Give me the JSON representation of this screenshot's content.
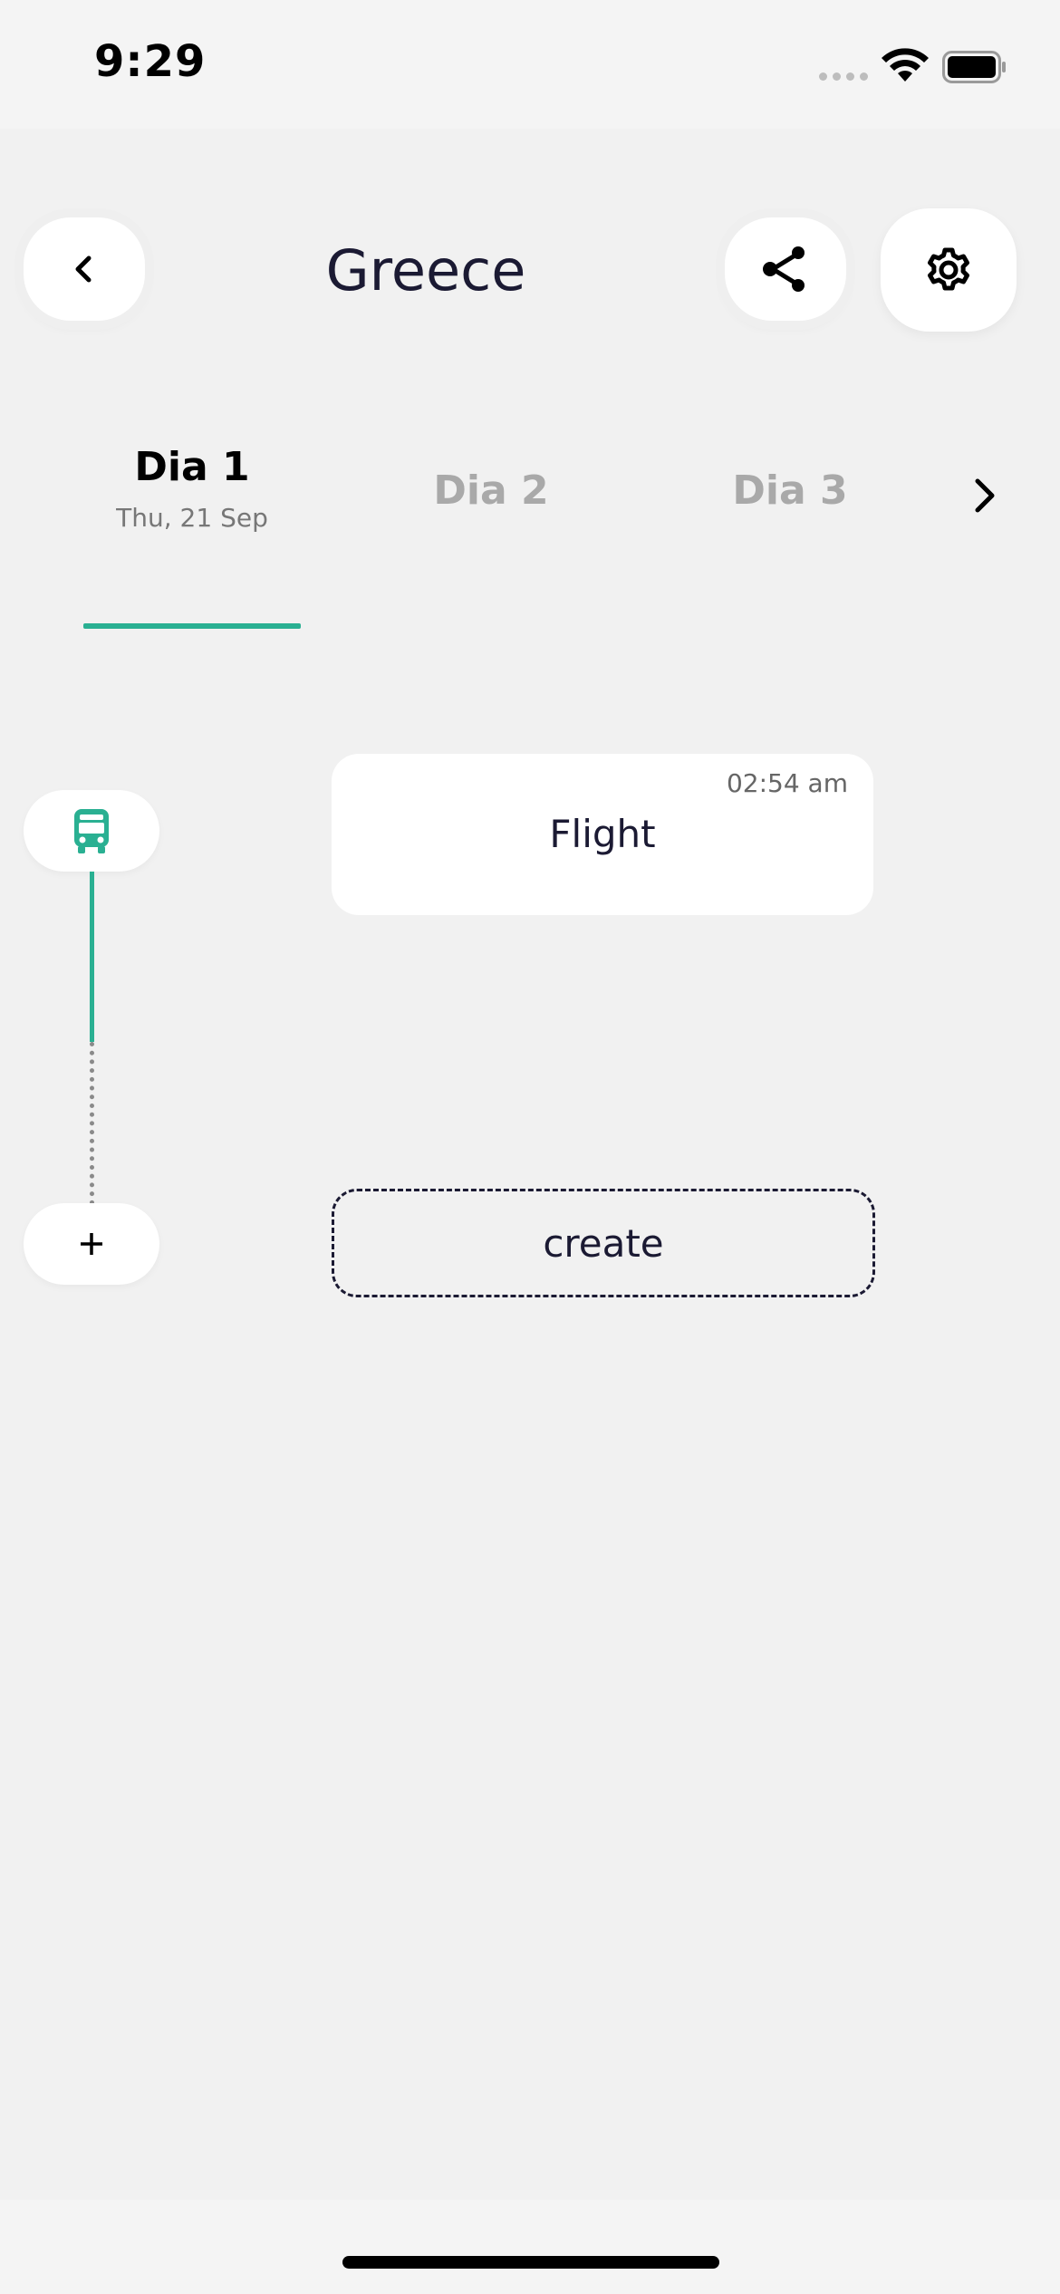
{
  "status": {
    "time": "9:29"
  },
  "header": {
    "title": "Greece",
    "back_icon": "chevron-left-icon",
    "share_icon": "share-icon",
    "settings_icon": "gear-icon"
  },
  "days": {
    "tabs": [
      {
        "label": "Dia 1",
        "date": "Thu, 21 Sep",
        "active": true
      },
      {
        "label": "Dia 2",
        "date": "",
        "active": false
      },
      {
        "label": "Dia 3",
        "date": "",
        "active": false
      }
    ],
    "next_icon": "chevron-right-icon"
  },
  "timeline": {
    "items": [
      {
        "icon": "bus-icon",
        "time": "02:54 am",
        "label": "Flight"
      }
    ],
    "add_icon": "plus-icon",
    "create_label": "create"
  },
  "colors": {
    "accent": "#2ab092",
    "text": "#1b1a33",
    "background": "#f1f1f1",
    "inactive_tab": "#a9a9a9"
  }
}
